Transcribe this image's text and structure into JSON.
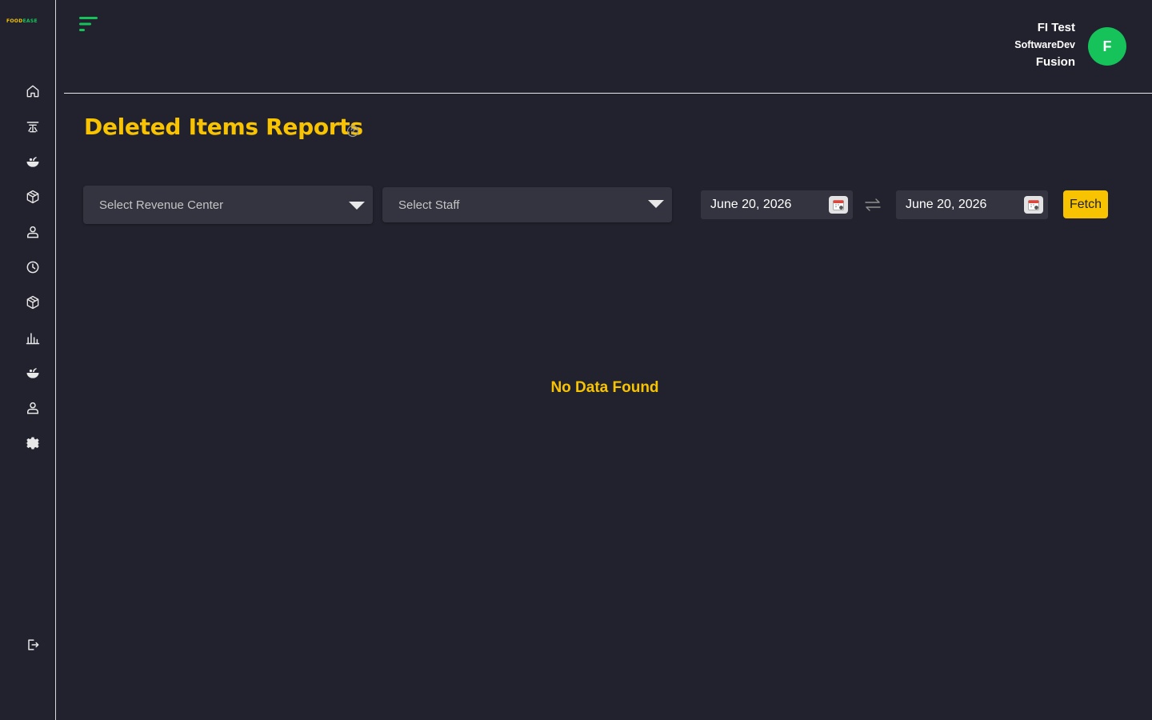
{
  "brand": {
    "logo_part1": "FOOD",
    "logo_part2": "EASE"
  },
  "user": {
    "name_line1": "FI Test",
    "name_line2": "SoftwareDev",
    "name_line3": "Fusion",
    "avatar_initial": "F"
  },
  "page": {
    "title": "Deleted Items Reports"
  },
  "filters": {
    "revenue_center_placeholder": "Select Revenue Center",
    "staff_placeholder": "Select Staff",
    "start_date": "June 20, 2026",
    "end_date": "June 20, 2026",
    "fetch_label": "Fetch"
  },
  "results": {
    "empty_message": "No Data Found"
  },
  "sidebar": {
    "items": [
      {
        "icon": "home-icon"
      },
      {
        "icon": "table-icon"
      },
      {
        "icon": "food-icon"
      },
      {
        "icon": "box-icon"
      },
      {
        "icon": "user-icon"
      },
      {
        "icon": "clock-icon"
      },
      {
        "icon": "inventory-icon"
      },
      {
        "icon": "chart-icon"
      },
      {
        "icon": "menu-food-icon"
      },
      {
        "icon": "staff-icon"
      },
      {
        "icon": "settings-icon"
      },
      {
        "icon": "logout-icon"
      }
    ]
  },
  "colors": {
    "background": "#22222e",
    "accent": "#f8c300",
    "brand_green": "#16c25a",
    "field": "#33343f"
  }
}
